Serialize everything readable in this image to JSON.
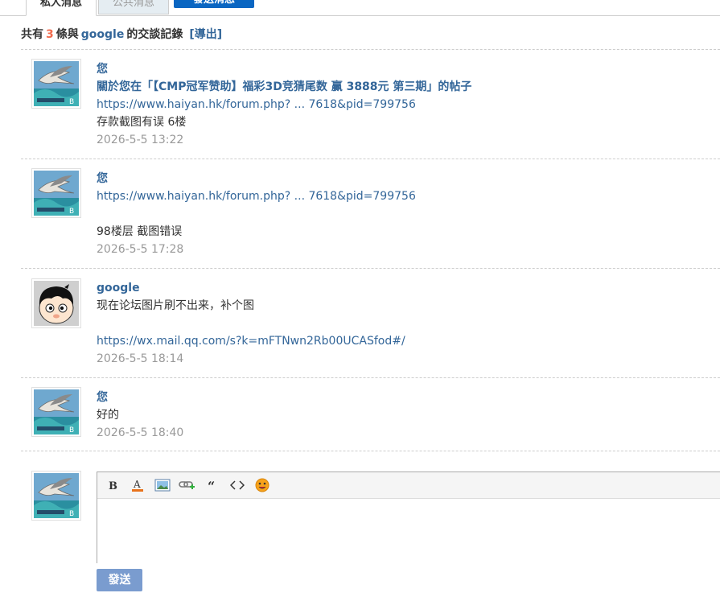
{
  "tabs": {
    "private": "私人消息",
    "public": "公共消息",
    "send": "發送消息"
  },
  "summary": {
    "prefix": "共有",
    "count": "3",
    "middle": "條與",
    "partner": "google",
    "suffix": "的交談記錄",
    "export": "[導出]"
  },
  "messages": [
    {
      "author": "您",
      "lines": [
        {
          "kind": "title",
          "text": "關於您在「【CMP冠军赞助】福彩3D竞猜尾数 赢 3888元  第三期」的帖子"
        },
        {
          "kind": "link",
          "text": "https://www.haiyan.hk/forum.php? ... 7618&pid=799756"
        },
        {
          "kind": "text",
          "text": "存款截图有误  6楼"
        }
      ],
      "time": "2026-5-5 13:22",
      "avatar": "seagull-avatar"
    },
    {
      "author": "您",
      "lines": [
        {
          "kind": "link",
          "text": "https://www.haiyan.hk/forum.php? ... 7618&pid=799756"
        },
        {
          "kind": "blank",
          "text": ""
        },
        {
          "kind": "text",
          "text": "98楼层 截图错误"
        }
      ],
      "time": "2026-5-5 17:28",
      "avatar": "seagull-avatar"
    },
    {
      "author": "google",
      "lines": [
        {
          "kind": "text",
          "text": "现在论坛图片刷不出来，补个图"
        },
        {
          "kind": "blank",
          "text": ""
        },
        {
          "kind": "link",
          "text": "https://wx.mail.qq.com/s?k=mFTNwn2Rb00UCASfod#/"
        }
      ],
      "time": "2026-5-5 18:14",
      "avatar": "cartoon-face-avatar"
    },
    {
      "author": "您",
      "lines": [
        {
          "kind": "text",
          "text": "好的"
        }
      ],
      "time": "2026-5-5 18:40",
      "avatar": "seagull-avatar"
    }
  ],
  "editor": {
    "toolbar": [
      "bold-icon",
      "font-color-icon",
      "image-icon",
      "link-add-icon",
      "quote-icon",
      "code-icon",
      "smiley-icon"
    ],
    "content": "",
    "submit_label": "發送"
  },
  "colors": {
    "link": "#336699",
    "count": "#f26c4f",
    "send_tab": "#0a66c2",
    "submit": "#7a9ccf",
    "time": "#999999"
  }
}
